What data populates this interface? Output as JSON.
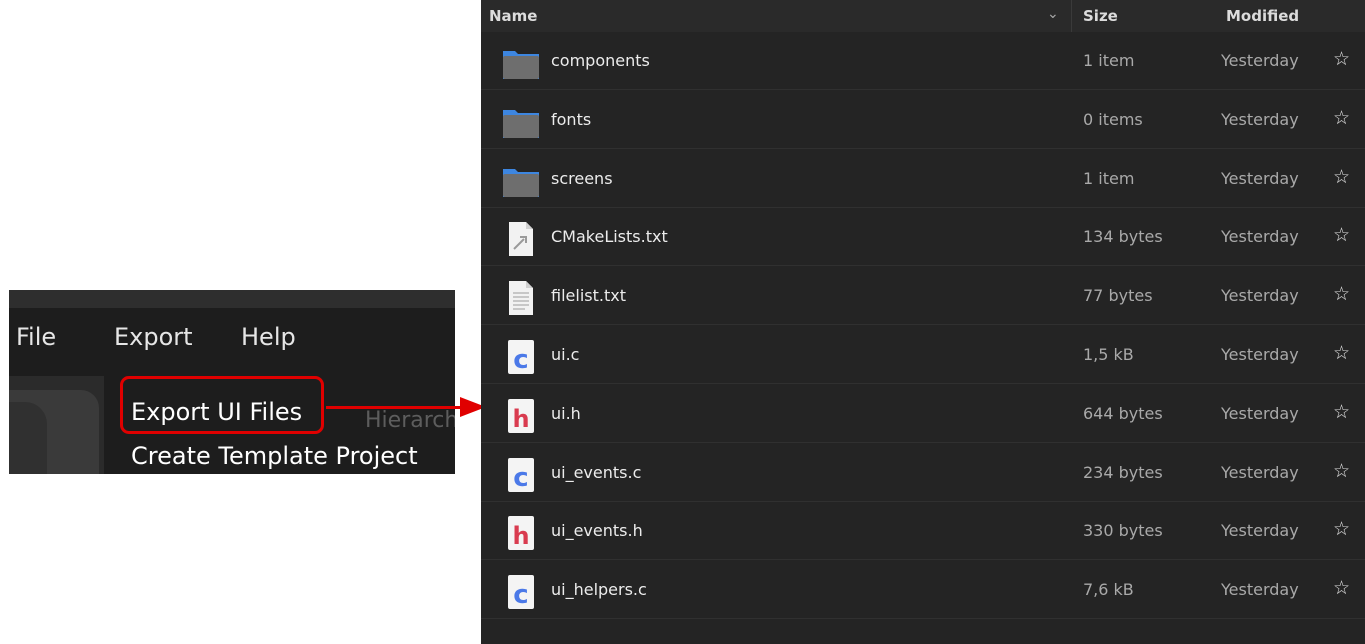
{
  "menubar": {
    "items": [
      "File",
      "Export",
      "Help"
    ],
    "dropdown": {
      "items": [
        "Export UI Files",
        "Create Template Project"
      ],
      "highlighted": "Export UI Files"
    },
    "background_label": "Hierarchy"
  },
  "colors": {
    "highlight": "#e00000",
    "folder_body": "#6e6e6e",
    "folder_tab": "#3d86e0",
    "c_letter": "#4b79e8",
    "h_letter": "#d93b4f"
  },
  "file_list": {
    "columns": {
      "name": "Name",
      "size": "Size",
      "modified": "Modified"
    },
    "sort_icon": "chevron-down-icon",
    "rows": [
      {
        "name": "components",
        "size": "1 item",
        "modified": "Yesterday",
        "icon": "folder-icon"
      },
      {
        "name": "fonts",
        "size": "0 items",
        "modified": "Yesterday",
        "icon": "folder-icon"
      },
      {
        "name": "screens",
        "size": "1 item",
        "modified": "Yesterday",
        "icon": "folder-icon"
      },
      {
        "name": "CMakeLists.txt",
        "size": "134 bytes",
        "modified": "Yesterday",
        "icon": "cmake-file-icon"
      },
      {
        "name": "filelist.txt",
        "size": "77 bytes",
        "modified": "Yesterday",
        "icon": "text-file-icon"
      },
      {
        "name": "ui.c",
        "size": "1,5 kB",
        "modified": "Yesterday",
        "icon": "c-source-icon"
      },
      {
        "name": "ui.h",
        "size": "644 bytes",
        "modified": "Yesterday",
        "icon": "c-header-icon"
      },
      {
        "name": "ui_events.c",
        "size": "234 bytes",
        "modified": "Yesterday",
        "icon": "c-source-icon"
      },
      {
        "name": "ui_events.h",
        "size": "330 bytes",
        "modified": "Yesterday",
        "icon": "c-header-icon"
      },
      {
        "name": "ui_helpers.c",
        "size": "7,6 kB",
        "modified": "Yesterday",
        "icon": "c-source-icon"
      }
    ]
  }
}
